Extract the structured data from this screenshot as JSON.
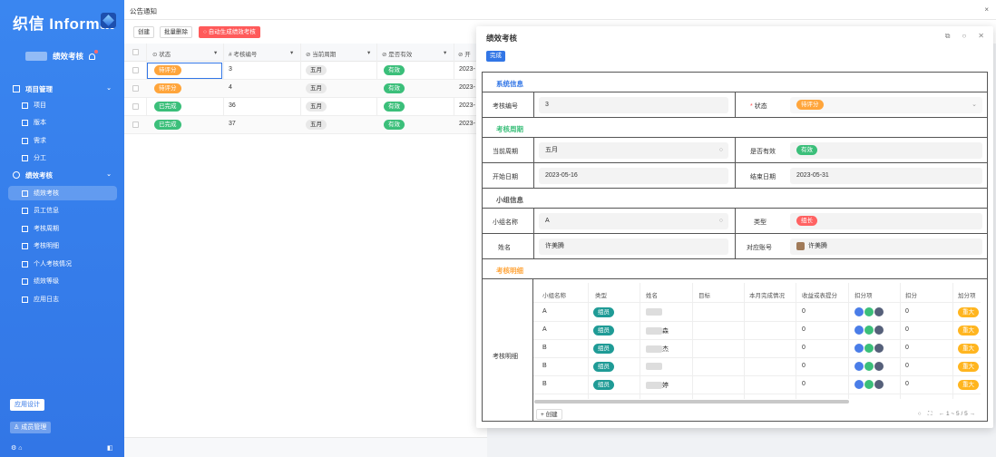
{
  "sidebar": {
    "logo": "织信 Informat",
    "user_name": "绩效考核",
    "groups": [
      {
        "label": "项目管理",
        "items": [
          "项目",
          "版本",
          "需求",
          "分工"
        ]
      },
      {
        "label": "绩效考核",
        "items": [
          "绩效考核",
          "员工信息",
          "考核周期",
          "考核明细",
          "个人考核情况",
          "绩效等级",
          "应用日志"
        ]
      }
    ],
    "active_item": "绩效考核",
    "app_design": "应用设计",
    "member_mgmt": "成员管理"
  },
  "topbar": {
    "title": "公告通知",
    "close": "×"
  },
  "toolbar": {
    "create": "创建",
    "batch_delete": "批量删除",
    "auto_gen": "自动生成绩效考核"
  },
  "grid": {
    "columns": [
      "状态",
      "考核编号",
      "当前周期",
      "是否有效",
      "开"
    ],
    "rows": [
      {
        "status": "待评分",
        "status_color": "#ffa53b",
        "id": "3",
        "period": "五月",
        "valid": "有效",
        "start": "2023-"
      },
      {
        "status": "待评分",
        "status_color": "#ffa53b",
        "id": "4",
        "period": "五月",
        "valid": "有效",
        "start": "2023-"
      },
      {
        "status": "已完成",
        "status_color": "#3bbf7a",
        "id": "36",
        "period": "五月",
        "valid": "有效",
        "start": "2023-"
      },
      {
        "status": "已完成",
        "status_color": "#3bbf7a",
        "id": "37",
        "period": "五月",
        "valid": "有效",
        "start": "2023-"
      }
    ]
  },
  "modal": {
    "title": "绩效考核",
    "done_btn": "完成",
    "sections": {
      "system": "系统信息",
      "cycle": "考核周期",
      "group": "小组信息",
      "detail": "考核明细"
    },
    "fields": {
      "id_label": "考核编号",
      "id_value": "3",
      "status_label": "状态",
      "status_value": "待评分",
      "period_label": "当前周期",
      "period_value": "五月",
      "valid_label": "是否有效",
      "valid_value": "有效",
      "start_label": "开始日期",
      "start_value": "2023-05-16",
      "end_label": "结束日期",
      "end_value": "2023-05-31",
      "group_name_label": "小组名称",
      "group_name_value": "A",
      "type_label": "类型",
      "type_value": "组长",
      "name_label": "姓名",
      "name_value": "许美腾",
      "account_label": "对应账号",
      "account_value": "许美腾",
      "detail_label": "考核明细"
    },
    "subtable": {
      "columns": [
        "小组名称",
        "类型",
        "姓名",
        "目标",
        "本月完成情况",
        "收益或表提分",
        "扣分项",
        "扣分",
        "加分项"
      ],
      "rows": [
        {
          "group": "A",
          "type": "组员",
          "name": "",
          "score_gain": "0",
          "deduct": "0",
          "bonus": "重大"
        },
        {
          "group": "A",
          "type": "组员",
          "name": "森",
          "score_gain": "0",
          "deduct": "0",
          "bonus": "重大"
        },
        {
          "group": "B",
          "type": "组员",
          "name": "杰",
          "score_gain": "0",
          "deduct": "0",
          "bonus": "重大"
        },
        {
          "group": "B",
          "type": "组员",
          "name": "",
          "score_gain": "0",
          "deduct": "0",
          "bonus": "重大"
        },
        {
          "group": "B",
          "type": "组员",
          "name": "婷",
          "score_gain": "0",
          "deduct": "0",
          "bonus": "重大"
        }
      ],
      "create": "+ 创建",
      "pager": "← 1 ~ 5 / 5 →"
    }
  }
}
